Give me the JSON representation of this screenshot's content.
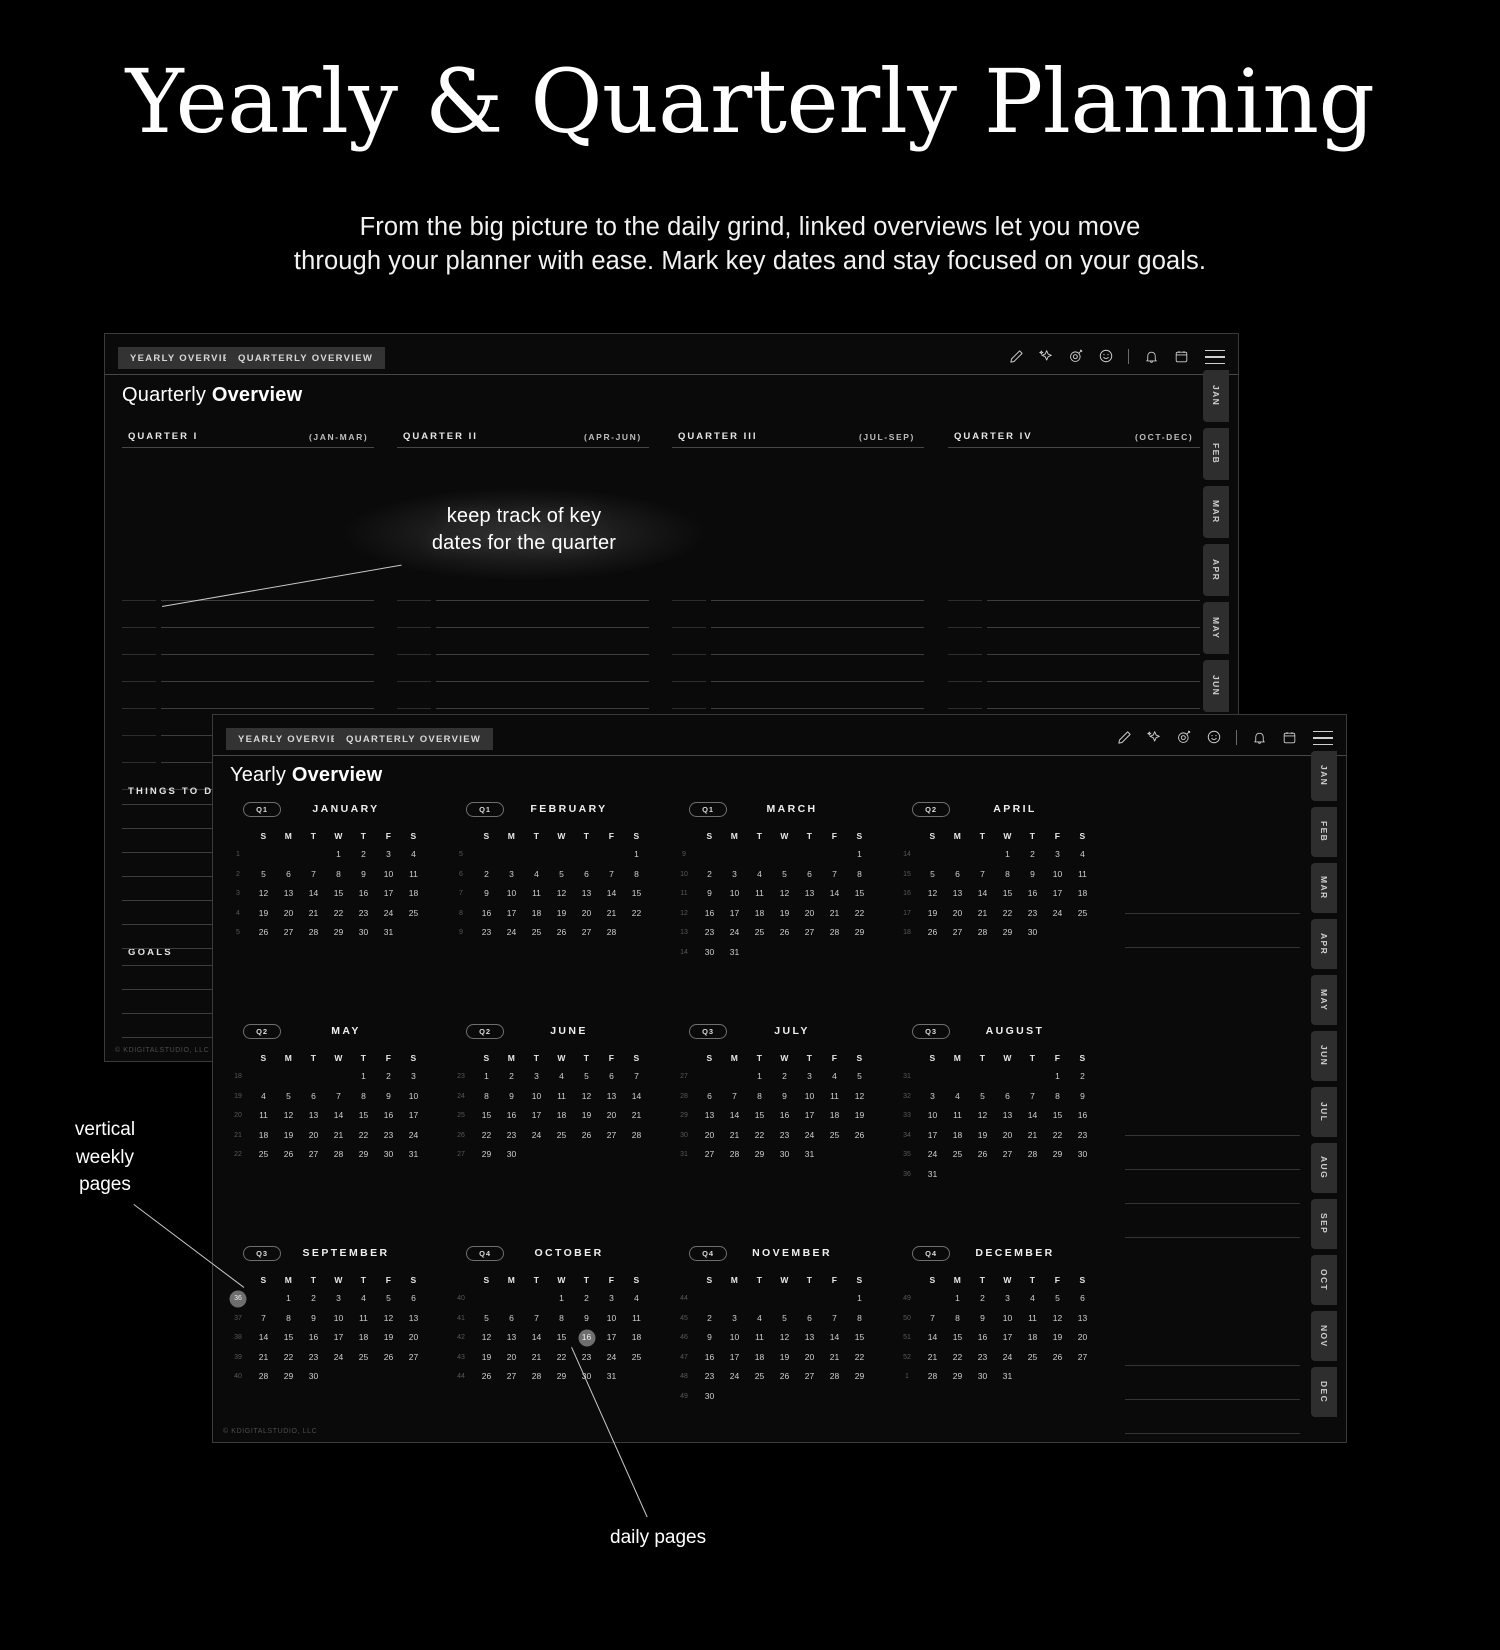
{
  "hero": {
    "title": "Yearly & Quarterly Planning",
    "subtitle_line1": "From the big picture to the daily grind, linked overviews let you move",
    "subtitle_line2": "through your planner with ease. Mark key dates and stay focused on your goals."
  },
  "quarterly_card": {
    "tabs": [
      "YEARLY OVERVIEW",
      "QUARTERLY OVERVIEW"
    ],
    "title_light": "Quarterly ",
    "title_bold": "Overview",
    "toolbar_icons": [
      "pencil-icon",
      "sparkle-icon",
      "target-pin-icon",
      "smiley-icon",
      "divider",
      "bell-icon",
      "calendar-icon",
      "hamburger-icon"
    ],
    "quarters": [
      {
        "label": "QUARTER I",
        "range": "(JAN-MAR)"
      },
      {
        "label": "QUARTER II",
        "range": "(APR-JUN)"
      },
      {
        "label": "QUARTER III",
        "range": "(JUL-SEP)"
      },
      {
        "label": "QUARTER IV",
        "range": "(OCT-DEC)"
      }
    ],
    "sections": [
      "THINGS TO DO",
      "GOALS"
    ],
    "month_rail": [
      "JAN",
      "FEB",
      "MAR",
      "APR",
      "MAY",
      "JUN"
    ],
    "footer": "© KDIGITALSTUDIO, LLC"
  },
  "yearly_card": {
    "tabs": [
      "YEARLY OVERVIEW",
      "QUARTERLY OVERVIEW"
    ],
    "title_light": "Yearly ",
    "title_bold": "Overview",
    "toolbar_icons": [
      "pencil-icon",
      "sparkle-icon",
      "target-pin-icon",
      "smiley-icon",
      "divider",
      "bell-icon",
      "calendar-icon",
      "hamburger-icon"
    ],
    "month_rail": [
      "JAN",
      "FEB",
      "MAR",
      "APR",
      "MAY",
      "JUN",
      "JUL",
      "AUG",
      "SEP",
      "OCT",
      "NOV",
      "DEC"
    ],
    "footer": "© KDIGITALSTUDIO, LLC",
    "dow": [
      "S",
      "M",
      "T",
      "W",
      "T",
      "F",
      "S"
    ],
    "months": [
      {
        "quarter": "Q1",
        "name": "JANUARY",
        "weeks": [
          "1",
          "2",
          "3",
          "4",
          "5"
        ],
        "rows": [
          [
            "",
            "",
            "",
            "1",
            "2",
            "3",
            "4"
          ],
          [
            "5",
            "6",
            "7",
            "8",
            "9",
            "10",
            "11"
          ],
          [
            "12",
            "13",
            "14",
            "15",
            "16",
            "17",
            "18"
          ],
          [
            "19",
            "20",
            "21",
            "22",
            "23",
            "24",
            "25"
          ],
          [
            "26",
            "27",
            "28",
            "29",
            "30",
            "31",
            ""
          ]
        ]
      },
      {
        "quarter": "Q1",
        "name": "FEBRUARY",
        "weeks": [
          "5",
          "6",
          "7",
          "8",
          "9"
        ],
        "rows": [
          [
            "",
            "",
            "",
            "",
            "",
            "",
            "1"
          ],
          [
            "2",
            "3",
            "4",
            "5",
            "6",
            "7",
            "8"
          ],
          [
            "9",
            "10",
            "11",
            "12",
            "13",
            "14",
            "15"
          ],
          [
            "16",
            "17",
            "18",
            "19",
            "20",
            "21",
            "22"
          ],
          [
            "23",
            "24",
            "25",
            "26",
            "27",
            "28",
            ""
          ]
        ]
      },
      {
        "quarter": "Q1",
        "name": "MARCH",
        "weeks": [
          "9",
          "10",
          "11",
          "12",
          "13",
          "14"
        ],
        "rows": [
          [
            "",
            "",
            "",
            "",
            "",
            "",
            "1"
          ],
          [
            "2",
            "3",
            "4",
            "5",
            "6",
            "7",
            "8"
          ],
          [
            "9",
            "10",
            "11",
            "12",
            "13",
            "14",
            "15"
          ],
          [
            "16",
            "17",
            "18",
            "19",
            "20",
            "21",
            "22"
          ],
          [
            "23",
            "24",
            "25",
            "26",
            "27",
            "28",
            "29"
          ],
          [
            "30",
            "31",
            "",
            "",
            "",
            "",
            ""
          ]
        ]
      },
      {
        "quarter": "Q2",
        "name": "APRIL",
        "weeks": [
          "14",
          "15",
          "16",
          "17",
          "18"
        ],
        "rows": [
          [
            "",
            "",
            "",
            "1",
            "2",
            "3",
            "4"
          ],
          [
            "5",
            "6",
            "7",
            "8",
            "9",
            "10",
            "11"
          ],
          [
            "12",
            "13",
            "14",
            "15",
            "16",
            "17",
            "18"
          ],
          [
            "19",
            "20",
            "21",
            "22",
            "23",
            "24",
            "25"
          ],
          [
            "26",
            "27",
            "28",
            "29",
            "30",
            "",
            ""
          ]
        ]
      },
      {
        "quarter": "Q2",
        "name": "MAY",
        "weeks": [
          "18",
          "19",
          "20",
          "21",
          "22"
        ],
        "rows": [
          [
            "",
            "",
            "",
            "",
            "1",
            "2",
            "3"
          ],
          [
            "4",
            "5",
            "6",
            "7",
            "8",
            "9",
            "10"
          ],
          [
            "11",
            "12",
            "13",
            "14",
            "15",
            "16",
            "17"
          ],
          [
            "18",
            "19",
            "20",
            "21",
            "22",
            "23",
            "24"
          ],
          [
            "25",
            "26",
            "27",
            "28",
            "29",
            "30",
            "31"
          ]
        ]
      },
      {
        "quarter": "Q2",
        "name": "JUNE",
        "weeks": [
          "23",
          "24",
          "25",
          "26",
          "27"
        ],
        "rows": [
          [
            "1",
            "2",
            "3",
            "4",
            "5",
            "6",
            "7"
          ],
          [
            "8",
            "9",
            "10",
            "11",
            "12",
            "13",
            "14"
          ],
          [
            "15",
            "16",
            "17",
            "18",
            "19",
            "20",
            "21"
          ],
          [
            "22",
            "23",
            "24",
            "25",
            "26",
            "27",
            "28"
          ],
          [
            "29",
            "30",
            "",
            "",
            "",
            "",
            ""
          ]
        ]
      },
      {
        "quarter": "Q3",
        "name": "JULY",
        "weeks": [
          "27",
          "28",
          "29",
          "30",
          "31"
        ],
        "rows": [
          [
            "",
            "",
            "1",
            "2",
            "3",
            "4",
            "5"
          ],
          [
            "6",
            "7",
            "8",
            "9",
            "10",
            "11",
            "12"
          ],
          [
            "13",
            "14",
            "15",
            "16",
            "17",
            "18",
            "19"
          ],
          [
            "20",
            "21",
            "22",
            "23",
            "24",
            "25",
            "26"
          ],
          [
            "27",
            "28",
            "29",
            "30",
            "31",
            "",
            ""
          ]
        ]
      },
      {
        "quarter": "Q3",
        "name": "AUGUST",
        "weeks": [
          "31",
          "32",
          "33",
          "34",
          "35",
          "36"
        ],
        "rows": [
          [
            "",
            "",
            "",
            "",
            "",
            "1",
            "2"
          ],
          [
            "3",
            "4",
            "5",
            "6",
            "7",
            "8",
            "9"
          ],
          [
            "10",
            "11",
            "12",
            "13",
            "14",
            "15",
            "16"
          ],
          [
            "17",
            "18",
            "19",
            "20",
            "21",
            "22",
            "23"
          ],
          [
            "24",
            "25",
            "26",
            "27",
            "28",
            "29",
            "30"
          ],
          [
            "31",
            "",
            "",
            "",
            "",
            "",
            ""
          ]
        ]
      },
      {
        "quarter": "Q3",
        "name": "SEPTEMBER",
        "weeks": [
          "36",
          "37",
          "38",
          "39",
          "40"
        ],
        "week_mark": 0,
        "rows": [
          [
            "",
            "1",
            "2",
            "3",
            "4",
            "5",
            "6"
          ],
          [
            "7",
            "8",
            "9",
            "10",
            "11",
            "12",
            "13"
          ],
          [
            "14",
            "15",
            "16",
            "17",
            "18",
            "19",
            "20"
          ],
          [
            "21",
            "22",
            "23",
            "24",
            "25",
            "26",
            "27"
          ],
          [
            "28",
            "29",
            "30",
            "",
            "",
            "",
            ""
          ]
        ]
      },
      {
        "quarter": "Q4",
        "name": "OCTOBER",
        "weeks": [
          "40",
          "41",
          "42",
          "43",
          "44"
        ],
        "day_mark": [
          2,
          4
        ],
        "rows": [
          [
            "",
            "",
            "",
            "1",
            "2",
            "3",
            "4"
          ],
          [
            "5",
            "6",
            "7",
            "8",
            "9",
            "10",
            "11"
          ],
          [
            "12",
            "13",
            "14",
            "15",
            "16",
            "17",
            "18"
          ],
          [
            "19",
            "20",
            "21",
            "22",
            "23",
            "24",
            "25"
          ],
          [
            "26",
            "27",
            "28",
            "29",
            "30",
            "31",
            ""
          ]
        ]
      },
      {
        "quarter": "Q4",
        "name": "NOVEMBER",
        "weeks": [
          "44",
          "45",
          "46",
          "47",
          "48",
          "49"
        ],
        "rows": [
          [
            "",
            "",
            "",
            "",
            "",
            "",
            "1"
          ],
          [
            "2",
            "3",
            "4",
            "5",
            "6",
            "7",
            "8"
          ],
          [
            "9",
            "10",
            "11",
            "12",
            "13",
            "14",
            "15"
          ],
          [
            "16",
            "17",
            "18",
            "19",
            "20",
            "21",
            "22"
          ],
          [
            "23",
            "24",
            "25",
            "26",
            "27",
            "28",
            "29"
          ],
          [
            "30",
            "",
            "",
            "",
            "",
            "",
            ""
          ]
        ]
      },
      {
        "quarter": "Q4",
        "name": "DECEMBER",
        "weeks": [
          "49",
          "50",
          "51",
          "52",
          "1"
        ],
        "rows": [
          [
            "",
            "1",
            "2",
            "3",
            "4",
            "5",
            "6"
          ],
          [
            "7",
            "8",
            "9",
            "10",
            "11",
            "12",
            "13"
          ],
          [
            "14",
            "15",
            "16",
            "17",
            "18",
            "19",
            "20"
          ],
          [
            "21",
            "22",
            "23",
            "24",
            "25",
            "26",
            "27"
          ],
          [
            "28",
            "29",
            "30",
            "31",
            "",
            "",
            ""
          ]
        ]
      }
    ]
  },
  "annotations": {
    "key_dates_line1": "keep track of key",
    "key_dates_line2": "dates for the quarter",
    "vertical_weekly_line1": "vertical",
    "vertical_weekly_line2": "weekly",
    "vertical_weekly_line3": "pages",
    "daily_pages": "daily pages"
  }
}
